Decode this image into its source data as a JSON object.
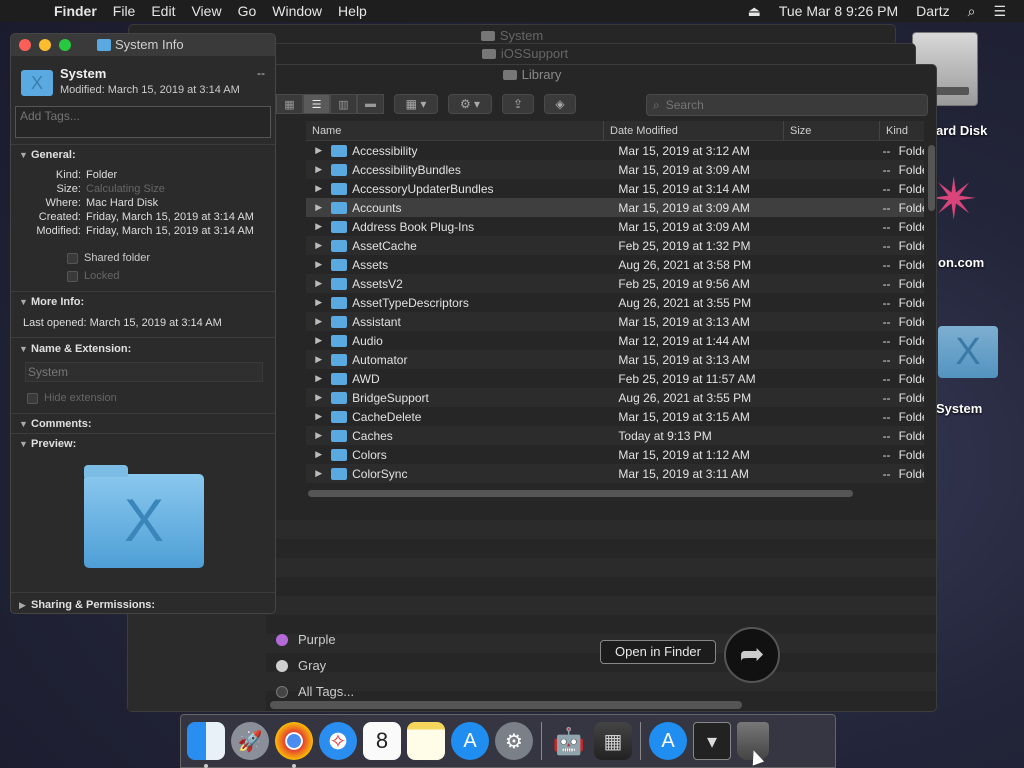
{
  "menubar": {
    "app": "Finder",
    "items": [
      "File",
      "Edit",
      "View",
      "Go",
      "Window",
      "Help"
    ],
    "clock": "Tue Mar 8  9:26 PM",
    "user": "Dartz"
  },
  "desktop": {
    "hd_label": "ard Disk",
    "site_label": "on.com",
    "system_label": "System"
  },
  "back_windows": [
    "System",
    "iOSSupport"
  ],
  "finder": {
    "title": "Library",
    "search_placeholder": "Search",
    "columns": {
      "name": "Name",
      "date": "Date Modified",
      "size": "Size",
      "kind": "Kind"
    },
    "rows": [
      {
        "name": "Accessibility",
        "date": "Mar 15, 2019 at 3:12 AM",
        "size": "--",
        "kind": "Folde"
      },
      {
        "name": "AccessibilityBundles",
        "date": "Mar 15, 2019 at 3:09 AM",
        "size": "--",
        "kind": "Folde"
      },
      {
        "name": "AccessoryUpdaterBundles",
        "date": "Mar 15, 2019 at 3:14 AM",
        "size": "--",
        "kind": "Folde"
      },
      {
        "name": "Accounts",
        "date": "Mar 15, 2019 at 3:09 AM",
        "size": "--",
        "kind": "Folde"
      },
      {
        "name": "Address Book Plug-Ins",
        "date": "Mar 15, 2019 at 3:09 AM",
        "size": "--",
        "kind": "Folde"
      },
      {
        "name": "AssetCache",
        "date": "Feb 25, 2019 at 1:32 PM",
        "size": "--",
        "kind": "Folde"
      },
      {
        "name": "Assets",
        "date": "Aug 26, 2021 at 3:58 PM",
        "size": "--",
        "kind": "Folde"
      },
      {
        "name": "AssetsV2",
        "date": "Feb 25, 2019 at 9:56 AM",
        "size": "--",
        "kind": "Folde"
      },
      {
        "name": "AssetTypeDescriptors",
        "date": "Aug 26, 2021 at 3:55 PM",
        "size": "--",
        "kind": "Folde"
      },
      {
        "name": "Assistant",
        "date": "Mar 15, 2019 at 3:13 AM",
        "size": "--",
        "kind": "Folde"
      },
      {
        "name": "Audio",
        "date": "Mar 12, 2019 at 1:44 AM",
        "size": "--",
        "kind": "Folde"
      },
      {
        "name": "Automator",
        "date": "Mar 15, 2019 at 3:13 AM",
        "size": "--",
        "kind": "Folde"
      },
      {
        "name": "AWD",
        "date": "Feb 25, 2019 at 11:57 AM",
        "size": "--",
        "kind": "Folde"
      },
      {
        "name": "BridgeSupport",
        "date": "Aug 26, 2021 at 3:55 PM",
        "size": "--",
        "kind": "Folde"
      },
      {
        "name": "CacheDelete",
        "date": "Mar 15, 2019 at 3:15 AM",
        "size": "--",
        "kind": "Folde"
      },
      {
        "name": "Caches",
        "date": "Today at 9:13 PM",
        "size": "--",
        "kind": "Folde"
      },
      {
        "name": "Colors",
        "date": "Mar 15, 2019 at 1:12 AM",
        "size": "--",
        "kind": "Folde"
      },
      {
        "name": "ColorSync",
        "date": "Mar 15, 2019 at 3:11 AM",
        "size": "--",
        "kind": "Folde"
      }
    ],
    "tags": [
      {
        "label": "Purple",
        "color": "#b26bd6"
      },
      {
        "label": "Gray",
        "color": "#cfcfcf"
      },
      {
        "label": "All Tags...",
        "color": "#444444"
      }
    ]
  },
  "info": {
    "window_title": "System Info",
    "name": "System",
    "dash": "--",
    "modified": "Modified: March 15, 2019 at 3:14 AM",
    "tags_placeholder": "Add Tags...",
    "general": {
      "header": "General:",
      "kind_k": "Kind:",
      "kind_v": "Folder",
      "size_k": "Size:",
      "size_v": "Calculating Size",
      "where_k": "Where:",
      "where_v": "Mac Hard Disk",
      "created_k": "Created:",
      "created_v": "Friday, March 15, 2019 at 3:14 AM",
      "modified_k": "Modified:",
      "modified_v": "Friday, March 15, 2019 at 3:14 AM",
      "shared": "Shared folder",
      "locked": "Locked"
    },
    "more_info": {
      "header": "More Info:",
      "last_opened": "Last opened: March 15, 2019 at 3:14 AM"
    },
    "name_ext": {
      "header": "Name & Extension:",
      "field": "System",
      "hide": "Hide extension"
    },
    "comments": "Comments:",
    "preview": "Preview:",
    "sharing": "Sharing & Permissions:"
  },
  "open_in_finder": "Open in Finder"
}
